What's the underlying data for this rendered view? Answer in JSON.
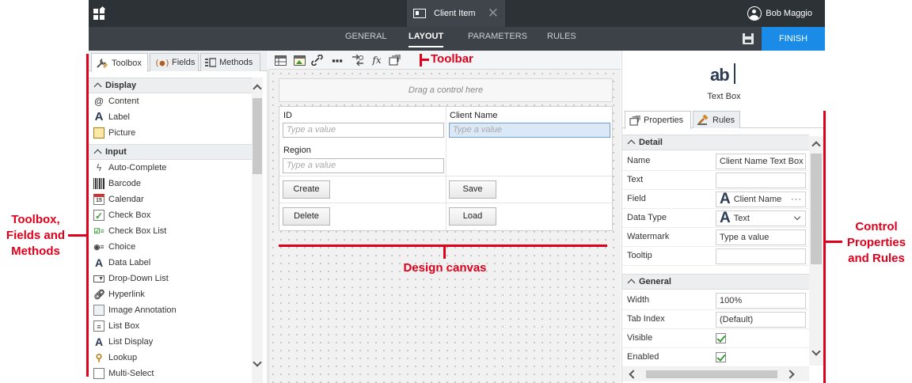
{
  "app": {
    "apps_icon": "apps-grid-icon",
    "document_tab": "Client Item",
    "user_name": "Bob Maggio",
    "nav_tabs": [
      "GENERAL",
      "LAYOUT",
      "PARAMETERS",
      "RULES"
    ],
    "active_tab": "LAYOUT",
    "finish_label": "FINISH"
  },
  "left_panel": {
    "tabs": [
      {
        "label": "Toolbox",
        "icon": "wrench-icon"
      },
      {
        "label": "Fields",
        "icon": "braces-icon"
      },
      {
        "label": "Methods",
        "icon": "methods-icon"
      }
    ],
    "sections": [
      {
        "title": "Display",
        "items": [
          "Content",
          "Label",
          "Picture"
        ]
      },
      {
        "title": "Input",
        "items": [
          "Auto-Complete",
          "Barcode",
          "Calendar",
          "Check Box",
          "Check Box List",
          "Choice",
          "Data Label",
          "Drop-Down List",
          "Hyperlink",
          "Image Annotation",
          "List Box",
          "List Display",
          "Lookup",
          "Multi-Select"
        ]
      }
    ]
  },
  "canvas": {
    "drop_hint": "Drag a control here",
    "fields": {
      "id_label": "ID",
      "client_name_label": "Client Name",
      "region_label": "Region",
      "placeholder": "Type a value"
    },
    "buttons": {
      "create": "Create",
      "save": "Save",
      "delete": "Delete",
      "load": "Load"
    }
  },
  "right_panel": {
    "control_icon_text": "ab",
    "control_type": "Text Box",
    "tabs": [
      {
        "label": "Properties",
        "icon": "properties-icon"
      },
      {
        "label": "Rules",
        "icon": "rules-gavel-icon"
      }
    ],
    "detail_section": "Detail",
    "detail": {
      "name_label": "Name",
      "name_value": "Client Name Text Box",
      "text_label": "Text",
      "text_value": "",
      "field_label": "Field",
      "field_value": "Client Name",
      "field_icon_text": "A",
      "datatype_label": "Data Type",
      "datatype_value": "Text",
      "datatype_icon_text": "A",
      "watermark_label": "Watermark",
      "watermark_value": "Type a value",
      "tooltip_label": "Tooltip",
      "tooltip_value": ""
    },
    "general_section": "General",
    "general": {
      "width_label": "Width",
      "width_value": "100%",
      "tabindex_label": "Tab Index",
      "tabindex_value": "(Default)",
      "visible_label": "Visible",
      "visible_checked": true,
      "enabled_label": "Enabled",
      "enabled_checked": true
    }
  },
  "annotations": {
    "toolbar": "Toolbar",
    "left_l1": "Toolbox,",
    "left_l2": "Fields and",
    "left_l3": "Methods",
    "canvas": "Design canvas",
    "right_l1": "Control",
    "right_l2": "Properties",
    "right_l3": "and Rules",
    "color": "#e0001b"
  },
  "colors": {
    "topbar": "#2d3237",
    "navbar": "#3c4248",
    "finish": "#1a8ce8",
    "selected_input": "#dbe9f6"
  }
}
